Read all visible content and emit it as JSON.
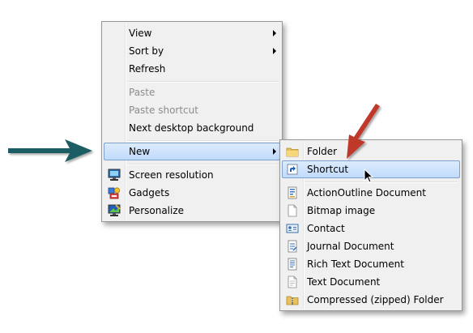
{
  "context_menu": {
    "items": [
      {
        "label": "View",
        "has_submenu": true
      },
      {
        "label": "Sort by",
        "has_submenu": true
      },
      {
        "label": "Refresh"
      },
      {
        "label": "Paste",
        "disabled": true
      },
      {
        "label": "Paste shortcut",
        "disabled": true
      },
      {
        "label": "Next desktop background"
      },
      {
        "label": "New",
        "has_submenu": true,
        "highlighted": true
      },
      {
        "label": "Screen resolution",
        "icon": "screen-resolution-icon"
      },
      {
        "label": "Gadgets",
        "icon": "gadgets-icon"
      },
      {
        "label": "Personalize",
        "icon": "personalize-icon"
      }
    ]
  },
  "new_submenu": {
    "items": [
      {
        "label": "Folder",
        "icon": "folder-icon"
      },
      {
        "label": "Shortcut",
        "icon": "shortcut-icon",
        "highlighted": true
      },
      {
        "label": "ActionOutline Document",
        "icon": "actionoutline-document-icon"
      },
      {
        "label": "Bitmap image",
        "icon": "bitmap-image-icon"
      },
      {
        "label": "Contact",
        "icon": "contact-icon"
      },
      {
        "label": "Journal Document",
        "icon": "journal-document-icon"
      },
      {
        "label": "Rich Text Document",
        "icon": "rich-text-document-icon"
      },
      {
        "label": "Text Document",
        "icon": "text-document-icon"
      },
      {
        "label": "Compressed (zipped) Folder",
        "icon": "compressed-folder-icon"
      }
    ]
  },
  "annotations": {
    "left_arrow_color": "#1d5b63",
    "down_arrow_color": "#c0392b"
  },
  "cursor": "mouse-pointer-icon"
}
